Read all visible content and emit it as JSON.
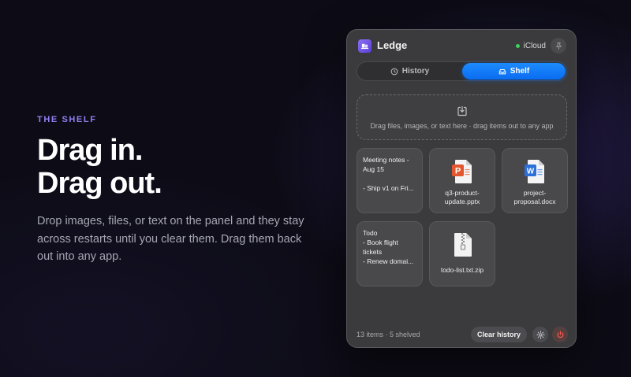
{
  "hero": {
    "eyebrow": "THE SHELF",
    "headline_line1": "Drag in.",
    "headline_line2": "Drag out.",
    "description": "Drop images, files, or text on the panel and they stay across restarts until you clear them. Drag them back out into any app."
  },
  "panel": {
    "app_name": "Ledge",
    "app_icon": "shelf-icon",
    "sync_label": "iCloud",
    "sync_status_color": "#3fd15d",
    "tabs": [
      {
        "label": "History",
        "icon": "clock-icon",
        "active": false
      },
      {
        "label": "Shelf",
        "icon": "tray-icon",
        "active": true
      }
    ],
    "accent_color": "#0a84ff",
    "dropzone_text": "Drag files, images, or text here · drag items out to any app",
    "items": [
      {
        "kind": "text",
        "text": "Meeting notes -\nAug 15\n\n- Ship v1 on Fri..."
      },
      {
        "kind": "file",
        "icon": "powerpoint-file-icon",
        "name": "q3-product-\nupdate.pptx"
      },
      {
        "kind": "file",
        "icon": "word-file-icon",
        "name": "project-\nproposal.docx"
      },
      {
        "kind": "text",
        "text": "Todo\n- Book flight\ntickets\n- Renew domai..."
      },
      {
        "kind": "file",
        "icon": "zip-file-icon",
        "name": "todo-list.txt.zip"
      }
    ],
    "footer": {
      "count": "13 items · 5 shelved",
      "clear_label": "Clear history",
      "settings_icon": "gear-icon",
      "quit_icon": "power-icon"
    }
  }
}
